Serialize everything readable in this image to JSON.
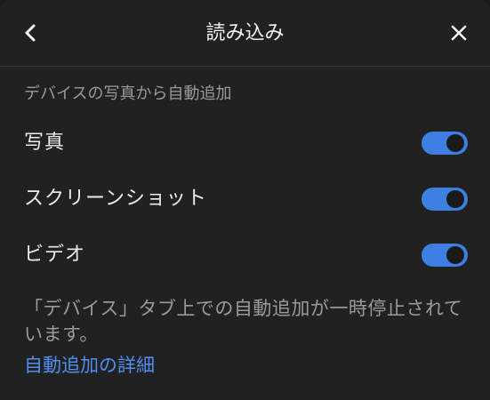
{
  "header": {
    "title": "読み込み",
    "back_icon": "chevron-left-icon",
    "close_icon": "close-icon"
  },
  "section": {
    "label": "デバイスの写真から自動追加"
  },
  "settings": [
    {
      "label": "写真",
      "enabled": true
    },
    {
      "label": "スクリーンショット",
      "enabled": true
    },
    {
      "label": "ビデオ",
      "enabled": true
    }
  ],
  "note": {
    "text": "「デバイス」タブ上での自動追加が一時停止されています。"
  },
  "link": {
    "label": "自動追加の詳細"
  },
  "colors": {
    "background": "#212121",
    "accent": "#3d7fe3",
    "link": "#4f8ff0"
  }
}
